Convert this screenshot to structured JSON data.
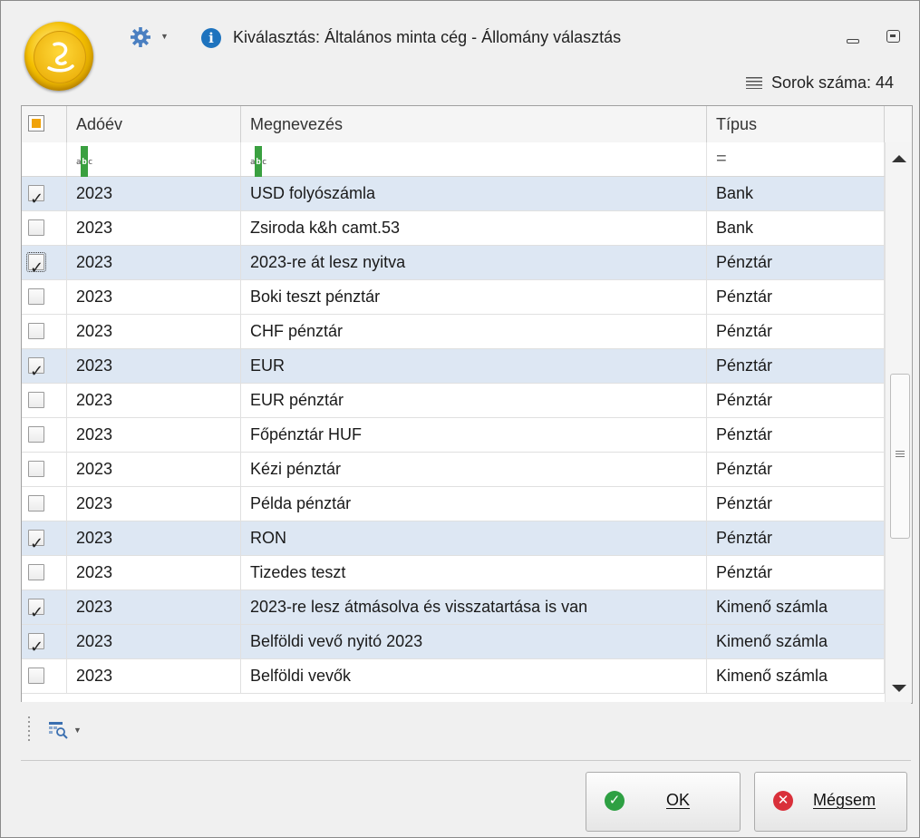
{
  "window": {
    "title": "Kiválasztás: Általános minta cég - Állomány választás",
    "row_count_label": "Sorok száma: 44"
  },
  "grid": {
    "columns": [
      {
        "key": "check",
        "label": ""
      },
      {
        "key": "year",
        "label": "Adóév"
      },
      {
        "key": "name",
        "label": "Megnevezés"
      },
      {
        "key": "type",
        "label": "Típus"
      }
    ],
    "filter": {
      "year_icon": "abc-filter-icon",
      "name_icon": "abc-filter-icon",
      "type_symbol": "="
    },
    "rows": [
      {
        "checked": true,
        "year": "2023",
        "name": "USD folyószámla",
        "type": "Bank"
      },
      {
        "checked": false,
        "year": "2023",
        "name": "Zsiroda k&h camt.53",
        "type": "Bank"
      },
      {
        "checked": true,
        "year": "2023",
        "name": "2023-re át lesz nyitva",
        "type": "Pénztár"
      },
      {
        "checked": false,
        "year": "2023",
        "name": "Boki teszt pénztár",
        "type": "Pénztár"
      },
      {
        "checked": false,
        "year": "2023",
        "name": "CHF pénztár",
        "type": "Pénztár"
      },
      {
        "checked": true,
        "year": "2023",
        "name": "EUR",
        "type": "Pénztár"
      },
      {
        "checked": false,
        "year": "2023",
        "name": "EUR pénztár",
        "type": "Pénztár"
      },
      {
        "checked": false,
        "year": "2023",
        "name": "Főpénztár HUF",
        "type": "Pénztár"
      },
      {
        "checked": false,
        "year": "2023",
        "name": "Kézi pénztár",
        "type": "Pénztár"
      },
      {
        "checked": false,
        "year": "2023",
        "name": "Példa pénztár",
        "type": "Pénztár"
      },
      {
        "checked": true,
        "year": "2023",
        "name": "RON",
        "type": "Pénztár"
      },
      {
        "checked": false,
        "year": "2023",
        "name": "Tizedes teszt",
        "type": "Pénztár"
      },
      {
        "checked": true,
        "year": "2023",
        "name": "2023-re lesz átmásolva és visszatartása is van",
        "type": "Kimenő számla"
      },
      {
        "checked": true,
        "year": "2023",
        "name": "Belföldi vevő nyitó 2023",
        "type": "Kimenő számla"
      },
      {
        "checked": false,
        "year": "2023",
        "name": "Belföldi vevők",
        "type": "Kimenő számla"
      }
    ]
  },
  "buttons": {
    "ok_label": "OK",
    "cancel_label": "Mégsem"
  },
  "colors": {
    "selected_row": "#dde7f3",
    "ok_green": "#2ea043",
    "cancel_red": "#d9303a",
    "info_blue": "#1e73be",
    "logo_gold": "#f5c000"
  },
  "icons": {
    "settings": "gear-icon",
    "info": "info-icon",
    "minimize": "minimize-icon",
    "maximize": "maximize-icon",
    "row_count": "list-icon",
    "find": "find-panel-icon"
  }
}
